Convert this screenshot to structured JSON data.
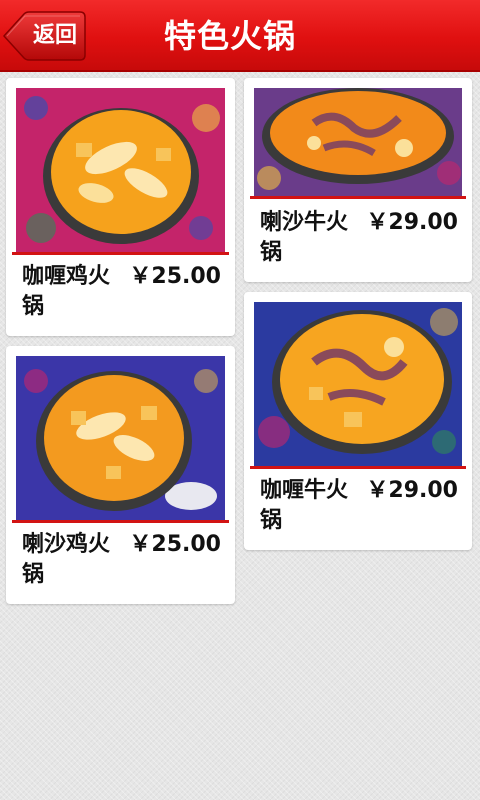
{
  "header": {
    "back_label": "返回",
    "title": "特色火锅",
    "color": "#e01010"
  },
  "dishes": [
    {
      "name": "咖喱鸡火锅",
      "price": "￥25.00",
      "cloth_color": "#c4246a",
      "broth_color": "#f6a21c",
      "meat": "chicken"
    },
    {
      "name": "喇沙牛火锅",
      "price": "￥29.00",
      "cloth_color": "#6a3c8a",
      "broth_color": "#f28a1a",
      "meat": "beef"
    },
    {
      "name": "喇沙鸡火锅",
      "price": "￥25.00",
      "cloth_color": "#3b36a8",
      "broth_color": "#f39a1f",
      "meat": "chicken"
    },
    {
      "name": "咖喱牛火锅",
      "price": "￥29.00",
      "cloth_color": "#2b3aa0",
      "broth_color": "#f7a520",
      "meat": "beef"
    }
  ]
}
